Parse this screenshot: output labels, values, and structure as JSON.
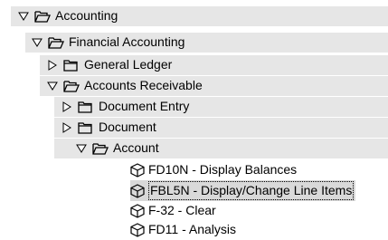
{
  "tree": {
    "accounting": {
      "label": "Accounting",
      "expanded": true
    },
    "financial_accounting": {
      "label": "Financial Accounting",
      "expanded": true
    },
    "general_ledger": {
      "label": "General Ledger",
      "expanded": false
    },
    "accounts_receivable": {
      "label": "Accounts Receivable",
      "expanded": true
    },
    "document_entry": {
      "label": "Document Entry",
      "expanded": false
    },
    "document": {
      "label": "Document",
      "expanded": false
    },
    "account": {
      "label": "Account",
      "expanded": true
    },
    "transactions": [
      {
        "label": "FD10N - Display Balances",
        "selected": false
      },
      {
        "label": "FBL5N - Display/Change Line Items",
        "selected": true
      },
      {
        "label": "F-32 - Clear",
        "selected": false
      },
      {
        "label": "FD11 - Analysis",
        "selected": false
      }
    ]
  },
  "colors": {
    "band": "#e6e6e6",
    "selection": "#d9d9d9"
  },
  "icons": {
    "expanded": "triangle-down-icon",
    "collapsed": "triangle-right-icon",
    "folder_open": "open-folder-icon",
    "folder_closed": "closed-folder-icon",
    "transaction": "transaction-cube-icon"
  }
}
